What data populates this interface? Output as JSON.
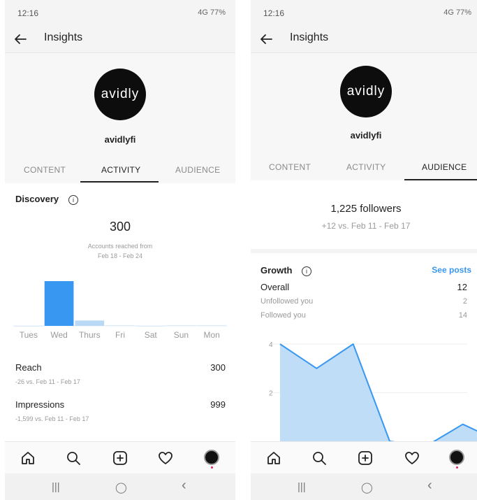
{
  "left": {
    "status": {
      "time": "12:16",
      "right": "4G 77%"
    },
    "header": {
      "title": "Insights"
    },
    "profile": {
      "avatar_text": "avidly",
      "username": "avidlyfi"
    },
    "tabs": [
      {
        "label": "CONTENT"
      },
      {
        "label": "ACTIVITY"
      },
      {
        "label": "AUDIENCE"
      }
    ],
    "active_tab": "ACTIVITY",
    "discovery": {
      "title": "Discovery",
      "count": "300",
      "caption_line1": "Accounts reached from",
      "caption_line2": "Feb 18 - Feb 24"
    },
    "chart_data": {
      "type": "bar",
      "categories": [
        "Tues",
        "Wed",
        "Thurs",
        "Fri",
        "Sat",
        "Sun",
        "Mon"
      ],
      "values": [
        0,
        250,
        30,
        2,
        0,
        2,
        2
      ],
      "highlight_color": "#3897f0",
      "base_color": "#b9d9f7"
    },
    "metrics": [
      {
        "label": "Reach",
        "value": "300",
        "sub": "-26 vs. Feb 11 - Feb 17"
      },
      {
        "label": "Impressions",
        "value": "999",
        "sub": "-1,599 vs. Feb 11 - Feb 17"
      }
    ]
  },
  "right": {
    "status": {
      "time": "12:16",
      "right": "4G 77%"
    },
    "header": {
      "title": "Insights"
    },
    "profile": {
      "avatar_text": "avidly",
      "username": "avidlyfi"
    },
    "tabs": [
      {
        "label": "CONTENT"
      },
      {
        "label": "ACTIVITY"
      },
      {
        "label": "AUDIENCE"
      }
    ],
    "active_tab": "AUDIENCE",
    "followers": {
      "count": "1,225 followers",
      "delta": "+12 vs. Feb 11 - Feb 17"
    },
    "growth": {
      "title": "Growth",
      "see_posts": "See posts",
      "rows": [
        {
          "label": "Overall",
          "value": "12"
        },
        {
          "label": "Unfollowed you",
          "value": "2"
        },
        {
          "label": "Followed you",
          "value": "14"
        }
      ]
    },
    "chart_data": {
      "type": "area",
      "x": [
        0,
        1,
        2,
        3,
        4,
        5,
        6
      ],
      "values": [
        4,
        3,
        4,
        0,
        -0.2,
        0.7,
        0
      ],
      "y_ticks": [
        "4",
        "2"
      ],
      "ylim": [
        0,
        4
      ],
      "color": "#3897f0",
      "fill": "#b9d9f7"
    }
  },
  "icons": {
    "back": "arrow-left-icon",
    "home": "home-icon",
    "search": "search-icon",
    "add": "add-post-icon",
    "heart": "heart-icon",
    "profile": "profile-avatar-icon"
  },
  "sysnav": {
    "recents": "|||",
    "home": "◯",
    "back": "‹"
  }
}
